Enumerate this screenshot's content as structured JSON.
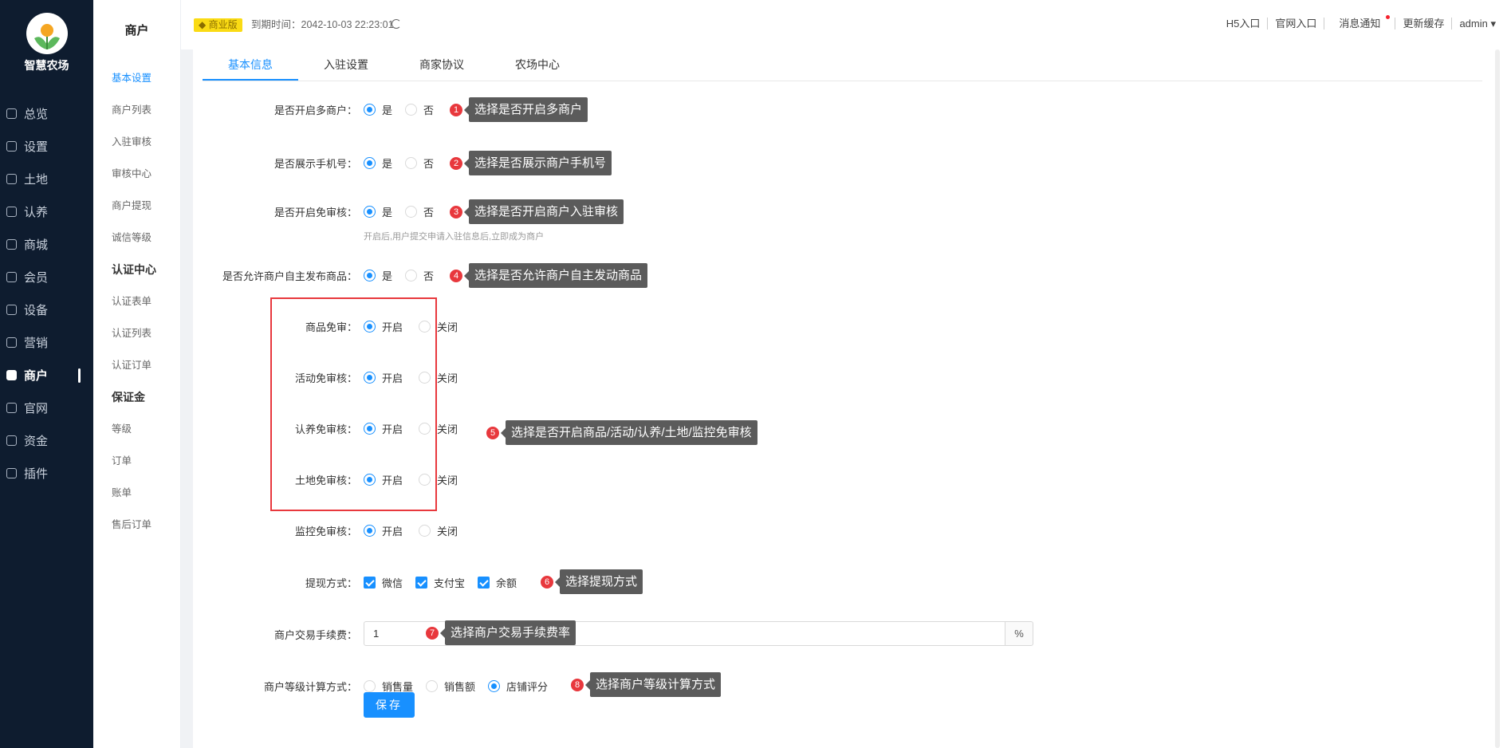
{
  "brand": {
    "title": "智慧农场"
  },
  "nav": [
    {
      "label": "总览",
      "icon": "dashboard-icon"
    },
    {
      "label": "设置",
      "icon": "gear-icon"
    },
    {
      "label": "土地",
      "icon": "grid-icon"
    },
    {
      "label": "认养",
      "icon": "adopt-icon"
    },
    {
      "label": "商城",
      "icon": "shop-icon"
    },
    {
      "label": "会员",
      "icon": "member-icon"
    },
    {
      "label": "设备",
      "icon": "device-icon"
    },
    {
      "label": "营销",
      "icon": "marketing-icon"
    },
    {
      "label": "商户",
      "icon": "merchant-icon",
      "active": true
    },
    {
      "label": "官网",
      "icon": "website-icon"
    },
    {
      "label": "资金",
      "icon": "funds-icon"
    },
    {
      "label": "插件",
      "icon": "plugin-icon"
    }
  ],
  "subnav": {
    "title": "商户",
    "items": [
      {
        "label": "基本设置",
        "active": true
      },
      {
        "label": "商户列表"
      },
      {
        "label": "入驻审核"
      },
      {
        "label": "审核中心"
      },
      {
        "label": "商户提现"
      },
      {
        "label": "诚信等级"
      },
      {
        "label": "认证中心",
        "group": true
      },
      {
        "label": "认证表单"
      },
      {
        "label": "认证列表"
      },
      {
        "label": "认证订单"
      },
      {
        "label": "保证金",
        "group": true
      },
      {
        "label": "等级"
      },
      {
        "label": "订单"
      },
      {
        "label": "账单"
      },
      {
        "label": "售后订单"
      }
    ]
  },
  "header": {
    "badge": "商业版",
    "expire": "到期时间：2042-10-03 22:23:01",
    "links": [
      "H5入口",
      "官网入口",
      "消息通知",
      "更新缓存",
      "admin ▾"
    ]
  },
  "tabs": [
    "基本信息",
    "入驻设置",
    "商家协议",
    "农场中心"
  ],
  "form": {
    "multi_merchant": {
      "label": "是否开启多商户：",
      "yes": "是",
      "no": "否"
    },
    "show_phone": {
      "label": "是否展示手机号：",
      "yes": "是",
      "no": "否"
    },
    "free_audit": {
      "label": "是否开启免审核：",
      "yes": "是",
      "no": "否",
      "hint": "开启后,用户提交申请入驻信息后,立即成为商户"
    },
    "self_publish": {
      "label": "是否允许商户自主发布商品：",
      "yes": "是",
      "no": "否"
    },
    "audit_items": [
      {
        "label": "商品免审：",
        "on": "开启",
        "off": "关闭"
      },
      {
        "label": "活动免审核：",
        "on": "开启",
        "off": "关闭"
      },
      {
        "label": "认养免审核：",
        "on": "开启",
        "off": "关闭"
      },
      {
        "label": "土地免审核：",
        "on": "开启",
        "off": "关闭"
      },
      {
        "label": "监控免审核：",
        "on": "开启",
        "off": "关闭"
      }
    ],
    "withdraw": {
      "label": "提现方式：",
      "options": [
        "微信",
        "支付宝",
        "余额"
      ]
    },
    "fee": {
      "label": "商户交易手续费：",
      "value": "1",
      "suffix": "%"
    },
    "level_calc": {
      "label": "商户等级计算方式：",
      "options": [
        "销售量",
        "销售额",
        "店铺评分"
      ],
      "selected": 2
    },
    "save": "保存"
  },
  "callouts": [
    {
      "num": "1",
      "text": "选择是否开启多商户"
    },
    {
      "num": "2",
      "text": "选择是否展示商户手机号"
    },
    {
      "num": "3",
      "text": "选择是否开启商户入驻审核"
    },
    {
      "num": "4",
      "text": "选择是否允许商户自主发动商品"
    },
    {
      "num": "5",
      "text": "选择是否开启商品/活动/认养/土地/监控免审核"
    },
    {
      "num": "6",
      "text": "选择提现方式"
    },
    {
      "num": "7",
      "text": "选择商户交易手续费率"
    },
    {
      "num": "8",
      "text": "选择商户等级计算方式"
    }
  ]
}
